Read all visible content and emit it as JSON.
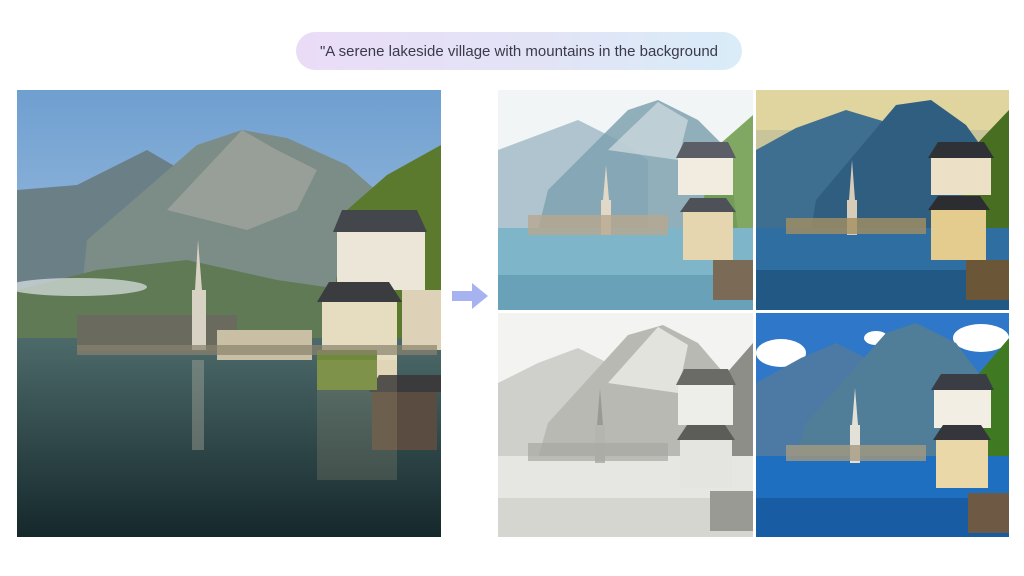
{
  "prompt": {
    "text": "\"A serene lakeside village with mountains in the background"
  },
  "images": {
    "source": {
      "icon": "photo-lakeside-village"
    },
    "outputs": [
      {
        "icon": "watercolor-lakeside-village"
      },
      {
        "icon": "oil-painting-lakeside-village"
      },
      {
        "icon": "pencil-sketch-lakeside-village"
      },
      {
        "icon": "photo-lakeside-village-blue-sky"
      }
    ]
  },
  "arrow": {
    "icon": "arrow-right-icon",
    "color": "#a7b3f0"
  },
  "colors": {
    "pill_start": "#eadcf7",
    "pill_end": "#d9ecf8",
    "prompt_text": "#3a3a4a"
  }
}
